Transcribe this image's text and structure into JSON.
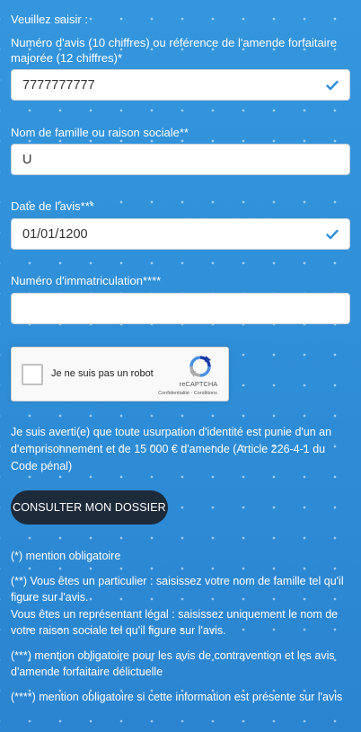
{
  "intro": "Veuillez saisir :",
  "fields": {
    "avis": {
      "label": "Numéro d'avis (10 chiffres) ou référence de l'amende forfaitaire majorée (12 chiffres)*",
      "value": "7777777777",
      "valid": true
    },
    "nom": {
      "label": "Nom de famille ou raison sociale**",
      "value": "U",
      "valid": false
    },
    "date": {
      "label": "Date de l'avis***",
      "value": "01/01/1200",
      "valid": true
    },
    "immat": {
      "label": "Numéro d'immatriculation****",
      "value": "",
      "valid": false
    }
  },
  "captcha": {
    "checkbox_label": "Je ne suis pas un robot",
    "brand": "reCAPTCHA",
    "links": "Confidentialité - Conditions"
  },
  "warning": "Je suis averti(e) que toute usurpation d'identité est punie d'un an d'emprisonnement et de 15 000 € d'amende (Article 226-4-1 du Code pénal)",
  "submit_label": "CONSULTER MON DOSSIER",
  "notes": {
    "n1": "(*) mention obligatoire",
    "n2a": "(**) Vous êtes un particulier : saisissez votre nom de famille tel qu'il figure sur l'avis.",
    "n2b": "Vous êtes un représentant légal : saisissez uniquement le nom de votre raison sociale tel qu'il figure sur l'avis.",
    "n3": "(***) mention obligatoire pour les avis de contravention et les avis d'amende forfaitaire délictuelle",
    "n4": "(****) mention obligatoire si cette information est présente sur l'avis"
  },
  "colors": {
    "background": "#2f8fd8",
    "check": "#2f8fd8",
    "button": "#1d2a3a"
  },
  "icons": [
    "checkmark-icon",
    "recaptcha-logo-icon"
  ]
}
